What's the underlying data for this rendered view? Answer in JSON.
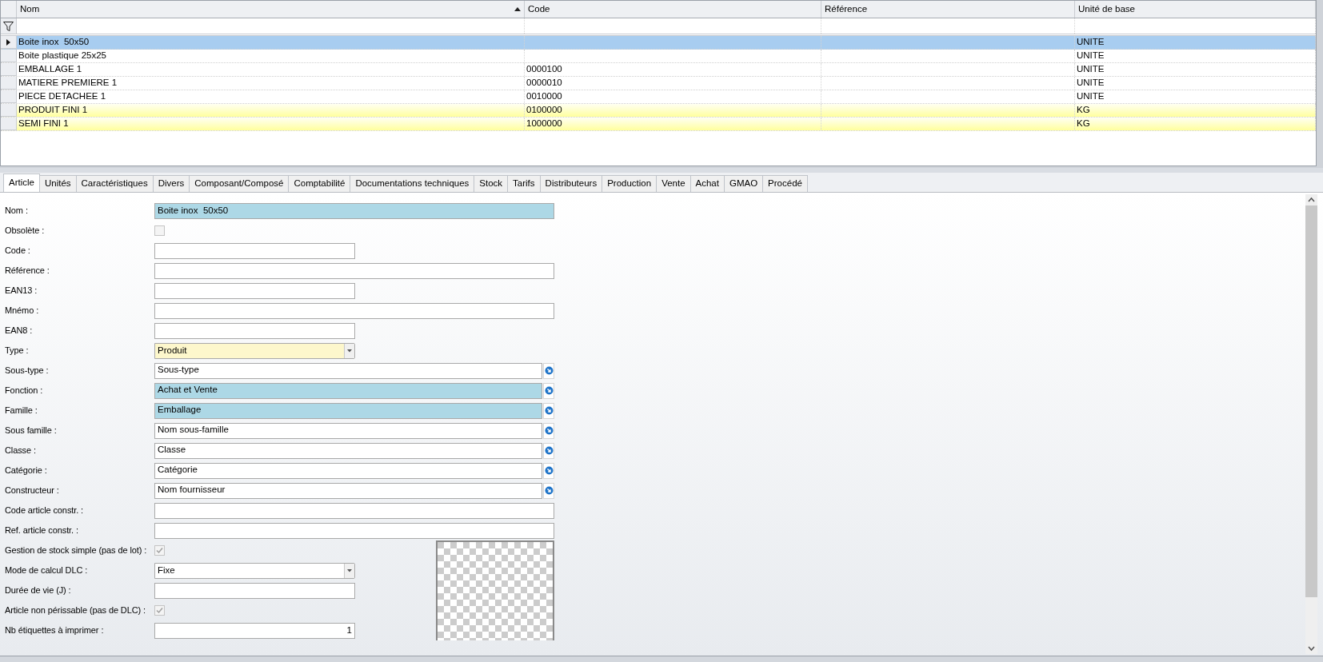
{
  "grid": {
    "columns": [
      {
        "label": "Nom",
        "sorted": true
      },
      {
        "label": "Code",
        "sorted": false
      },
      {
        "label": "Référence",
        "sorted": false
      },
      {
        "label": "Unité de base",
        "sorted": false
      }
    ],
    "rows": [
      {
        "name": "Boite inox  50x50",
        "unit": "UNITE",
        "selected": true,
        "highlighted": false
      },
      {
        "name": "Boite plastique 25x25",
        "unit": "UNITE",
        "selected": false,
        "highlighted": false
      },
      {
        "name": "EMBALLAGE 1",
        "code": "0000100",
        "unit": "UNITE",
        "selected": false,
        "highlighted": false
      },
      {
        "name": "MATIERE PREMIERE 1",
        "code": "0000010",
        "unit": "UNITE",
        "selected": false,
        "highlighted": false
      },
      {
        "name": "PIECE DETACHEE 1",
        "code": "0010000",
        "unit": "UNITE",
        "selected": false,
        "highlighted": false
      },
      {
        "name": "PRODUIT FINI 1",
        "code": "0100000",
        "unit": "KG",
        "selected": false,
        "highlighted": true
      },
      {
        "name": "SEMI FINI 1",
        "code": "1000000",
        "unit": "KG",
        "selected": false,
        "highlighted": true
      }
    ]
  },
  "tabs": [
    {
      "label": "Article",
      "selected": true
    },
    {
      "label": "Unités",
      "selected": false
    },
    {
      "label": "Caractéristiques",
      "selected": false
    },
    {
      "label": "Divers",
      "selected": false
    },
    {
      "label": "Composant/Composé",
      "selected": false
    },
    {
      "label": "Comptabilité",
      "selected": false
    },
    {
      "label": "Documentations techniques",
      "selected": false
    },
    {
      "label": "Stock",
      "selected": false
    },
    {
      "label": "Tarifs",
      "selected": false
    },
    {
      "label": "Distributeurs",
      "selected": false
    },
    {
      "label": "Production",
      "selected": false
    },
    {
      "label": "Vente",
      "selected": false
    },
    {
      "label": "Achat",
      "selected": false
    },
    {
      "label": "GMAO",
      "selected": false
    },
    {
      "label": "Procédé",
      "selected": false
    }
  ],
  "fields": [
    {
      "label": "Nom :",
      "kind": "long",
      "value": "Boite inox  50x50",
      "color": "#add8e6"
    },
    {
      "label": "Obsolète :",
      "kind": "checkbox",
      "checked": false
    },
    {
      "label": "Code :",
      "kind": "short"
    },
    {
      "label": "Référence :",
      "kind": "long"
    },
    {
      "label": "EAN13 :",
      "kind": "short"
    },
    {
      "label": "Mnémo :",
      "kind": "long"
    },
    {
      "label": "EAN8 :",
      "kind": "short"
    },
    {
      "label": "Type :",
      "kind": "select",
      "value": "Produit",
      "color": "#fdf7cc"
    },
    {
      "label": "Sous-type :",
      "kind": "lookup",
      "value": "Sous-type"
    },
    {
      "label": "Fonction :",
      "kind": "lookup",
      "value": "Achat et Vente",
      "color": "#add8e6"
    },
    {
      "label": "Famille :",
      "kind": "lookup",
      "value": "Emballage",
      "color": "#add8e6"
    },
    {
      "label": "Sous famille :",
      "kind": "lookup",
      "value": "Nom sous-famille"
    },
    {
      "label": "Classe :",
      "kind": "lookup",
      "value": "Classe"
    },
    {
      "label": "Catégorie :",
      "kind": "lookup",
      "value": "Catégorie"
    },
    {
      "label": "Constructeur :",
      "kind": "lookup",
      "value": "Nom fournisseur"
    },
    {
      "label": "Code article constr. :",
      "kind": "long"
    },
    {
      "label": "Ref. article constr. :",
      "kind": "long"
    },
    {
      "label": "Gestion de stock simple (pas de lot) :",
      "kind": "checkbox",
      "checked": true
    },
    {
      "label": "Mode de calcul DLC :",
      "kind": "select",
      "value": "Fixe"
    },
    {
      "label": "Durée de vie (J) :",
      "kind": "short"
    },
    {
      "label": "Article non périssable (pas de DLC) :",
      "kind": "checkbox",
      "checked": true
    },
    {
      "label": "Nb étiquettes à imprimer :",
      "kind": "number",
      "value": "1"
    }
  ]
}
